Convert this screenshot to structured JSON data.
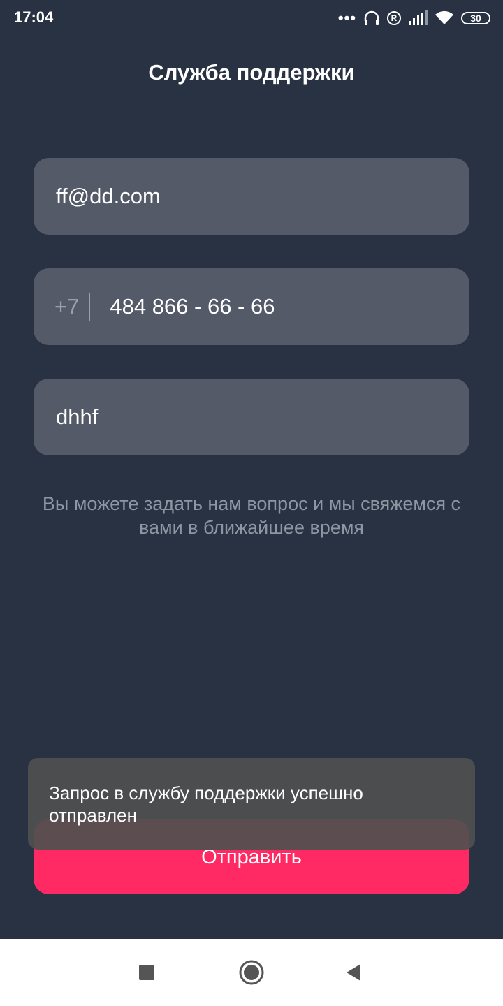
{
  "status_bar": {
    "time": "17:04",
    "battery": "30",
    "icons": [
      "more-dots-icon",
      "headphones-icon",
      "registered-icon",
      "signal-icon",
      "wifi-icon",
      "battery-icon"
    ]
  },
  "header": {
    "title": "Служба поддержки"
  },
  "form": {
    "email_value": "ff@dd.com",
    "phone_prefix": "+7",
    "phone_value": "484 866 - 66 - 66",
    "message_value": "dhhf",
    "helper_text": "Вы можете задать нам вопрос и мы свяжемся с вами в ближайшее время",
    "submit_label": "Отправить"
  },
  "toast": {
    "message": "Запрос в службу поддержки успешно отправлен"
  },
  "nav_bar": {
    "icons": [
      "recents-square-icon",
      "home-circle-icon",
      "back-triangle-icon"
    ]
  },
  "colors": {
    "background": "#283242",
    "field": "#545a68",
    "accent": "#ff2a63",
    "toast": "#505050"
  }
}
